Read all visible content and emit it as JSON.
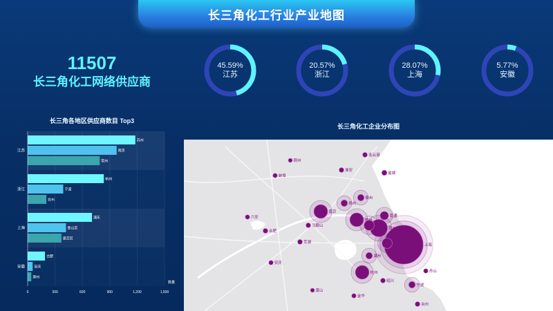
{
  "header": {
    "title": "长三角化工行业产业地图"
  },
  "summary": {
    "total": "11507",
    "label": "长三角化工网络供应商"
  },
  "rings": [
    {
      "percent": "45.59%",
      "region": "江苏",
      "value": 0.4559
    },
    {
      "percent": "20.57%",
      "region": "浙江",
      "value": 0.2057
    },
    {
      "percent": "28.07%",
      "region": "上海",
      "value": 0.2807
    },
    {
      "percent": "5.77%",
      "region": "安徽",
      "value": 0.0577
    }
  ],
  "colors": {
    "ring_track": "#2e45b8",
    "ring_fill": "#5ff3ff",
    "bar1": "#6ff6ff",
    "bar2": "#4fc3ee",
    "bar3": "#3aa6ae",
    "map_marker": "#7a0f7a"
  },
  "chart_data": [
    {
      "type": "bar",
      "orientation": "horizontal",
      "title": "长三角各地区供应商数目 Top3",
      "xlabel": "数量",
      "xlim": [
        0,
        1500
      ],
      "xticks": [
        "0",
        "300",
        "600",
        "900",
        "1,200",
        "1,500"
      ],
      "groups": [
        {
          "name": "江苏",
          "items": [
            {
              "label": "苏州",
              "value": 1180
            },
            {
              "label": "南京",
              "value": 975
            },
            {
              "label": "常州",
              "value": 790
            }
          ]
        },
        {
          "name": "浙江",
          "items": [
            {
              "label": "杭州",
              "value": 835
            },
            {
              "label": "宁波",
              "value": 390
            },
            {
              "label": "台州",
              "value": 205
            }
          ]
        },
        {
          "name": "上海",
          "items": [
            {
              "label": "浦东",
              "value": 705
            },
            {
              "label": "金山区",
              "value": 420
            },
            {
              "label": "嘉定区",
              "value": 370
            }
          ]
        },
        {
          "name": "安徽",
          "items": [
            {
              "label": "合肥",
              "value": 190
            },
            {
              "label": "安庆",
              "value": 55
            },
            {
              "label": "滁州",
              "value": 40
            }
          ]
        }
      ]
    },
    {
      "type": "scatter",
      "title": "长三角化工企业分布图",
      "points": [
        {
          "label": "上海",
          "value": 10
        },
        {
          "label": "苏州",
          "value": 4
        },
        {
          "label": "南京",
          "value": 3
        },
        {
          "label": "常州",
          "value": 3
        },
        {
          "label": "杭州",
          "value": 3
        },
        {
          "label": "嘉兴",
          "value": 2
        },
        {
          "label": "无锡",
          "value": 2
        },
        {
          "label": "南通",
          "value": 1.5
        },
        {
          "label": "泰州",
          "value": 1
        },
        {
          "label": "扬州",
          "value": 1
        },
        {
          "label": "湖州",
          "value": 1
        },
        {
          "label": "宁波",
          "value": 1
        },
        {
          "label": "盐城",
          "value": 0.6
        },
        {
          "label": "淮安",
          "value": 0.5
        },
        {
          "label": "连云港",
          "value": 0.5
        },
        {
          "label": "合肥",
          "value": 0.5
        },
        {
          "label": "蚌埠",
          "value": 0.4
        },
        {
          "label": "安庆",
          "value": 0.4
        },
        {
          "label": "芜湖",
          "value": 0.5
        },
        {
          "label": "马鞍山",
          "value": 0.5
        },
        {
          "label": "绍兴",
          "value": 0.5
        },
        {
          "label": "台州",
          "value": 0.5
        },
        {
          "label": "舟山",
          "value": 0.4
        },
        {
          "label": "金华",
          "value": 0.4
        },
        {
          "label": "六安",
          "value": 0.4
        },
        {
          "label": "宿州",
          "value": 0.3
        },
        {
          "label": "黄山",
          "value": 0.3
        }
      ]
    }
  ]
}
